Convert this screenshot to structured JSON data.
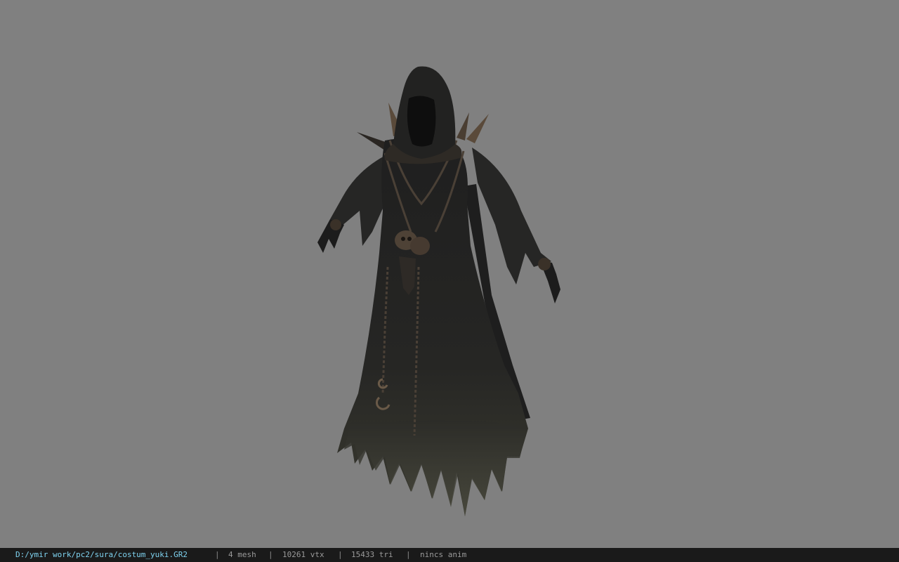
{
  "viewer": {
    "background_color": "#808080",
    "model_subject": "hooded-reaper-costume"
  },
  "status_bar": {
    "file_path": "D:/ymir work/pc2/sura/costum_yuki.GR2",
    "separator": "|",
    "mesh_count": "4 mesh",
    "vertex_count": "10261 vtx",
    "triangle_count": "15433 tri",
    "animation": "nincs anim",
    "path_color": "#7fd3f0",
    "text_color": "#9a9a9a"
  }
}
